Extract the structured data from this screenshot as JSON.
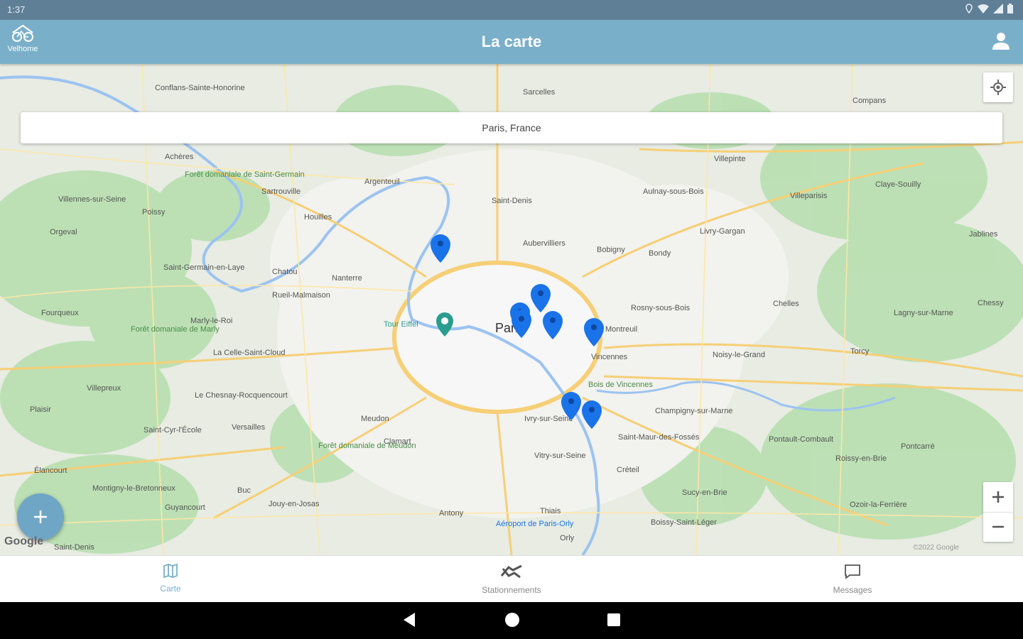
{
  "status_bar": {
    "time": "1:37"
  },
  "app_bar": {
    "title": "La carte",
    "logo_text": "Velhome"
  },
  "search": {
    "value": "Paris, France"
  },
  "map": {
    "attribution": "Google",
    "copyright": "©2022 Google",
    "labels": [
      "Conflans-Sainte-Honorine",
      "Sarcelles",
      "Compans",
      "Argenteuil",
      "Saint-Denis",
      "Aulnay-sous-Bois",
      "Villepinte",
      "Villeparisis",
      "Claye-Souilly",
      "Sartrouville",
      "Houilles",
      "Aubervilliers",
      "Bobigny",
      "Bondy",
      "Livry-Gargan",
      "Nanterre",
      "Chatou",
      "Rueil-Malmaison",
      "Paris",
      "Tour Eiffel",
      "Rosny-sous-Bois",
      "Montreuil",
      "Vincennes",
      "Noisy-le-Grand",
      "Chelles",
      "Lagny-sur-Marne",
      "Torcy",
      "Bois de Vincennes",
      "Champigny-sur-Marne",
      "Saint-Maur-des-Fossés",
      "Créteil",
      "Vitry-sur-Seine",
      "Ivry-sur-Seine",
      "Meudon",
      "Clamart",
      "Versailles",
      "Le Chesnay-Rocquencourt",
      "La Celle-Saint-Cloud",
      "Saint-Germain-en-Laye",
      "Poissy",
      "Villennes-sur-Seine",
      "Orgeval",
      "Achères",
      "Fourqueux",
      "Marly-le-Roi",
      "Villepreux",
      "Plaisir",
      "Saint-Cyr-l'École",
      "Guyancourt",
      "Montigny-le-Bretonneux",
      "Élancourt",
      "Buc",
      "Jouy-en-Josas",
      "Antony",
      "Thiais",
      "Orly",
      "Aéroport de Paris-Orly",
      "Sucy-en-Brie",
      "Boissy-Saint-Léger",
      "Ozoir-la-Ferrière",
      "Pontcarré",
      "Roissy-en-Brie",
      "Pontault-Combault",
      "Forêt domaniale de Saint-Germain",
      "Forêt domaniale de Marly",
      "Forêt domaniale de Meudon",
      "Jablines",
      "Chessy",
      "Saint-Denis"
    ]
  },
  "bottom_nav": {
    "items": [
      {
        "label": "Carte"
      },
      {
        "label": "Stationnements"
      },
      {
        "label": "Messages"
      }
    ]
  },
  "colors": {
    "app_bar": "#7aafc9",
    "status_bar": "#5f7f97",
    "pin": "#1a73e8",
    "active_nav": "#7aafc9",
    "fab": "#6fa6c6"
  },
  "icons": [
    "bike-icon",
    "profile-icon",
    "my-location-icon",
    "zoom-in-icon",
    "zoom-out-icon",
    "add-icon",
    "map-icon",
    "bike-parking-icon",
    "chat-icon",
    "back-icon",
    "home-icon",
    "recent-apps-icon",
    "location-pin-icon",
    "landmark-icon"
  ]
}
